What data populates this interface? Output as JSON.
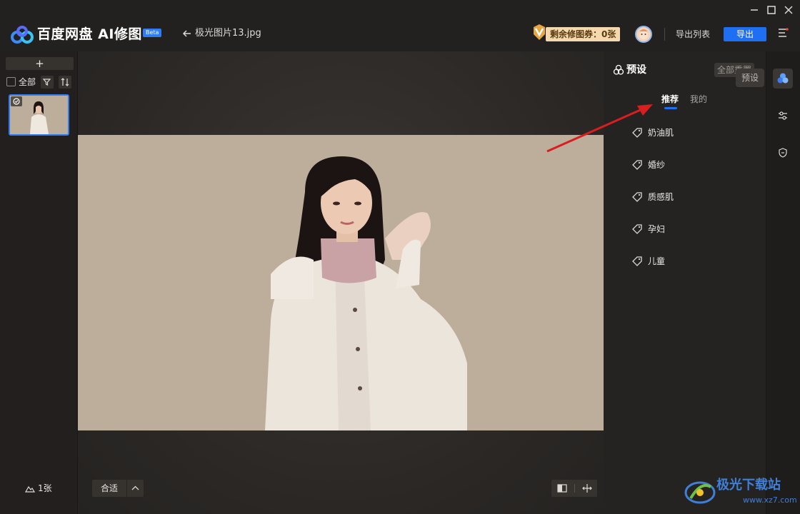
{
  "app": {
    "title": "百度网盘 AI修图",
    "beta_badge": "Beta",
    "file_name": "极光图片13.jpg",
    "coupon_text": "剩余修图券：0张",
    "export_list_label": "导出列表",
    "export_button_label": "导出",
    "accent_color": "#1e6ff2"
  },
  "left_panel": {
    "add_label": "+",
    "select_all_label": "全部",
    "count_label": "1张"
  },
  "canvas": {
    "fit_label": "合适"
  },
  "presets": {
    "title": "预设",
    "reset_all_label": "全部重置",
    "tooltip": "预设",
    "tabs": [
      {
        "label": "推荐",
        "active": true
      },
      {
        "label": "我的",
        "active": false
      }
    ],
    "items": [
      {
        "label": "奶油肌"
      },
      {
        "label": "婚纱"
      },
      {
        "label": "质感肌"
      },
      {
        "label": "孕妇"
      },
      {
        "label": "儿童"
      }
    ]
  },
  "watermark": {
    "text": "极光下载站",
    "url": "www.xz7.com"
  }
}
